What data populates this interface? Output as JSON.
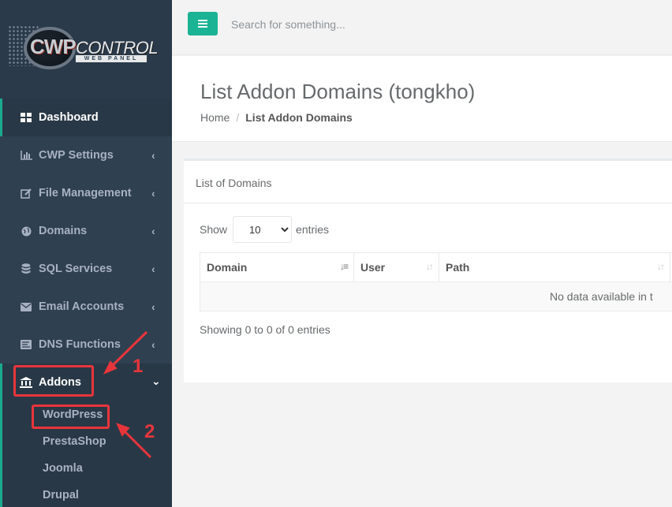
{
  "brand": {
    "name": "CWP",
    "name_suffix": "CONTROL",
    "tagline": "WEB PANEL"
  },
  "topbar": {
    "search_placeholder": "Search for something..."
  },
  "sidebar": {
    "items": [
      {
        "label": "Dashboard",
        "icon": "dashboard-icon"
      },
      {
        "label": "CWP Settings",
        "icon": "bar-chart-icon"
      },
      {
        "label": "File Management",
        "icon": "edit-icon"
      },
      {
        "label": "Domains",
        "icon": "globe-icon"
      },
      {
        "label": "SQL Services",
        "icon": "database-icon"
      },
      {
        "label": "Email Accounts",
        "icon": "envelope-icon"
      },
      {
        "label": "DNS Functions",
        "icon": "signal-icon"
      },
      {
        "label": "Addons",
        "icon": "bank-icon"
      }
    ],
    "addons_sub": [
      "WordPress",
      "PrestaShop",
      "Joomla",
      "Drupal"
    ]
  },
  "page": {
    "title": "List Addon Domains (tongkho)",
    "breadcrumb": {
      "home": "Home",
      "separator": "/",
      "current": "List Addon Domains"
    }
  },
  "box": {
    "title": "List of Domains",
    "show_label": "Show",
    "entries_label": "entries",
    "page_length": "10",
    "columns": [
      "Domain",
      "User",
      "Path"
    ],
    "empty_text": "No data available in t",
    "info_text": "Showing 0 to 0 of 0 entries"
  },
  "annotations": {
    "step1": "1",
    "step2": "2"
  },
  "colors": {
    "accent": "#1ab394",
    "sidebar": "#2f4050",
    "annotation": "#e8353b"
  }
}
